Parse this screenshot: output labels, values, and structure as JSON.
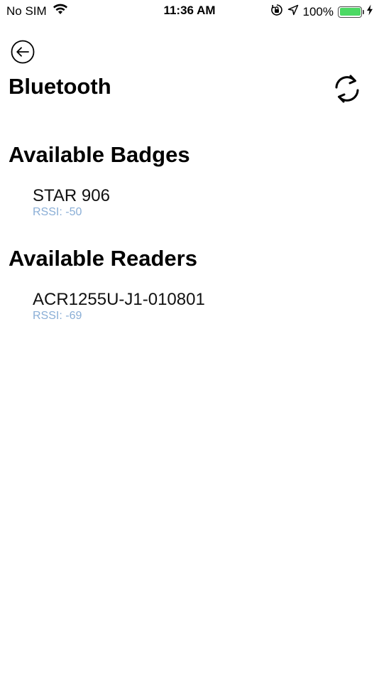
{
  "status_bar": {
    "carrier": "No SIM",
    "time": "11:36 AM",
    "battery_percent": "100%",
    "battery_level": 1.0,
    "icons": [
      "wifi-icon",
      "orientation-lock-icon",
      "location-arrow-icon",
      "battery-icon",
      "charging-bolt-icon"
    ],
    "battery_color": "#4cd964"
  },
  "header": {
    "title": "Bluetooth",
    "back_icon": "back-arrow-circle-icon",
    "refresh_icon": "refresh-icon"
  },
  "sections": {
    "badges": {
      "title": "Available Badges",
      "items": [
        {
          "name": "STAR 906",
          "rssi": "RSSI: -50"
        }
      ]
    },
    "readers": {
      "title": "Available Readers",
      "items": [
        {
          "name": "ACR1255U-J1-010801",
          "rssi": "RSSI: -69"
        }
      ]
    }
  },
  "colors": {
    "rssi_text": "#8aaed6",
    "title_text": "#000000"
  }
}
